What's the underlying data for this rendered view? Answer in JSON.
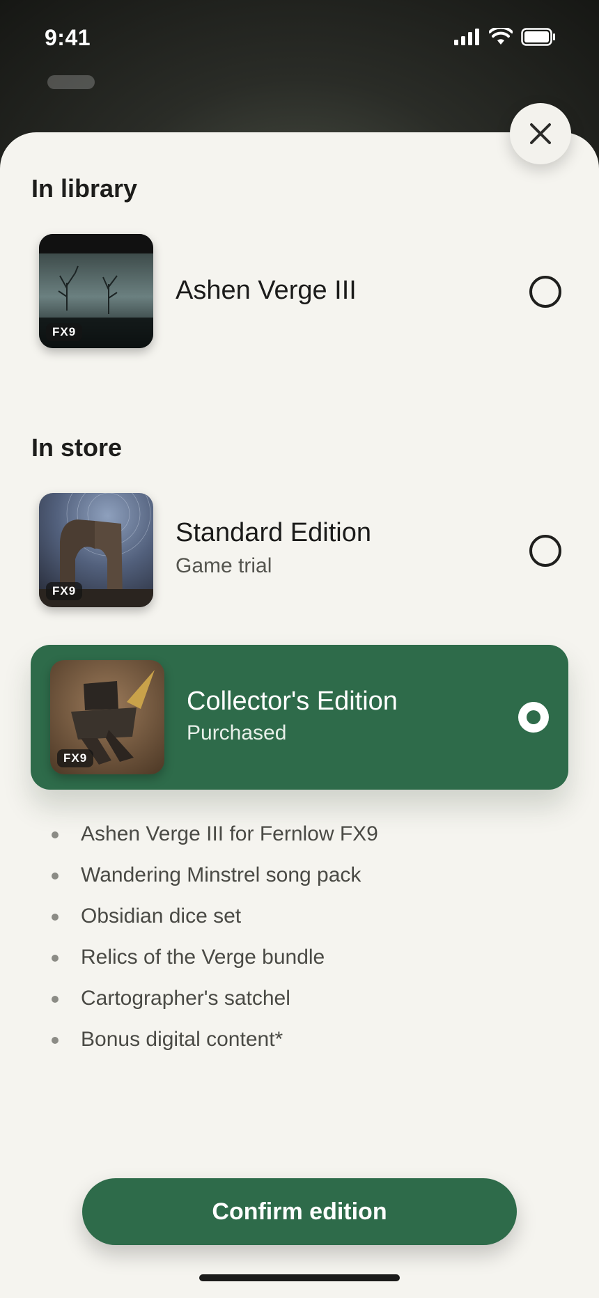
{
  "status_bar": {
    "time": "9:41"
  },
  "sheet": {
    "close_icon": "close-icon",
    "in_library": {
      "heading": "In library",
      "items": [
        {
          "title": "Ashen Verge III",
          "badge": "FX9"
        }
      ]
    },
    "in_store": {
      "heading": "In store",
      "items": [
        {
          "title": "Standard Edition",
          "subtitle": "Game trial",
          "badge": "FX9",
          "selected": false
        },
        {
          "title": "Collector's Edition",
          "subtitle": "Purchased",
          "badge": "FX9",
          "selected": true
        }
      ]
    },
    "features": [
      "Ashen Verge III for Fernlow FX9",
      "Wandering Minstrel song pack",
      "Obsidian dice set",
      "Relics of the Verge bundle",
      "Cartographer's satchel",
      "Bonus digital content*"
    ],
    "confirm_label": "Confirm edition"
  },
  "colors": {
    "accent": "#2e6b4a",
    "sheet_bg": "#f5f4ef"
  }
}
